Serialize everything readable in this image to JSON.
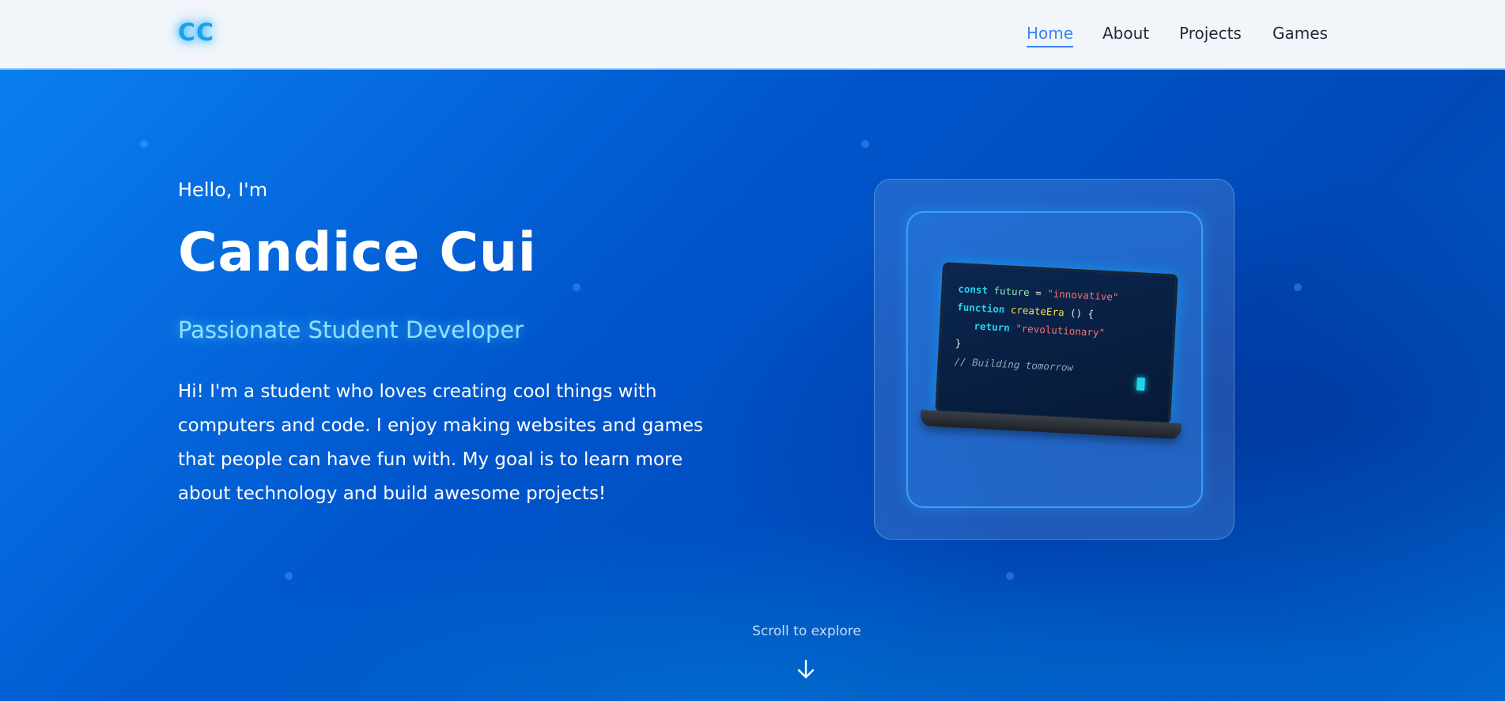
{
  "nav": {
    "logo": "CC",
    "links": [
      "Home",
      "About",
      "Projects",
      "Games"
    ],
    "active": "Home"
  },
  "hero": {
    "greeting": "Hello, I'm",
    "name": "Candice Cui",
    "subtitle": "Passionate Student Developer",
    "bio": "Hi! I'm a student who loves creating cool things with computers and code. I enjoy making websites and games that people can have fun with. My goal is to learn more about technology and build awesome projects!"
  },
  "code": {
    "line1": {
      "kw": "const",
      "ident": "future",
      "op": " = ",
      "str": "\"innovative\""
    },
    "line2": {
      "kw": "function",
      "fn": "createEra",
      "rest": " () {"
    },
    "line3": {
      "kw": "return",
      "str": "\"revolutionary\""
    },
    "line4": "}",
    "line5": "// Building tomorrow"
  },
  "scroll": {
    "label": "Scroll to explore",
    "icon": "arrow-down-icon"
  },
  "colors": {
    "accent": "#3b82f6",
    "logo": "#1da1ee",
    "subtitle": "#8fe3ff",
    "hero_bg": "#0055cc"
  }
}
